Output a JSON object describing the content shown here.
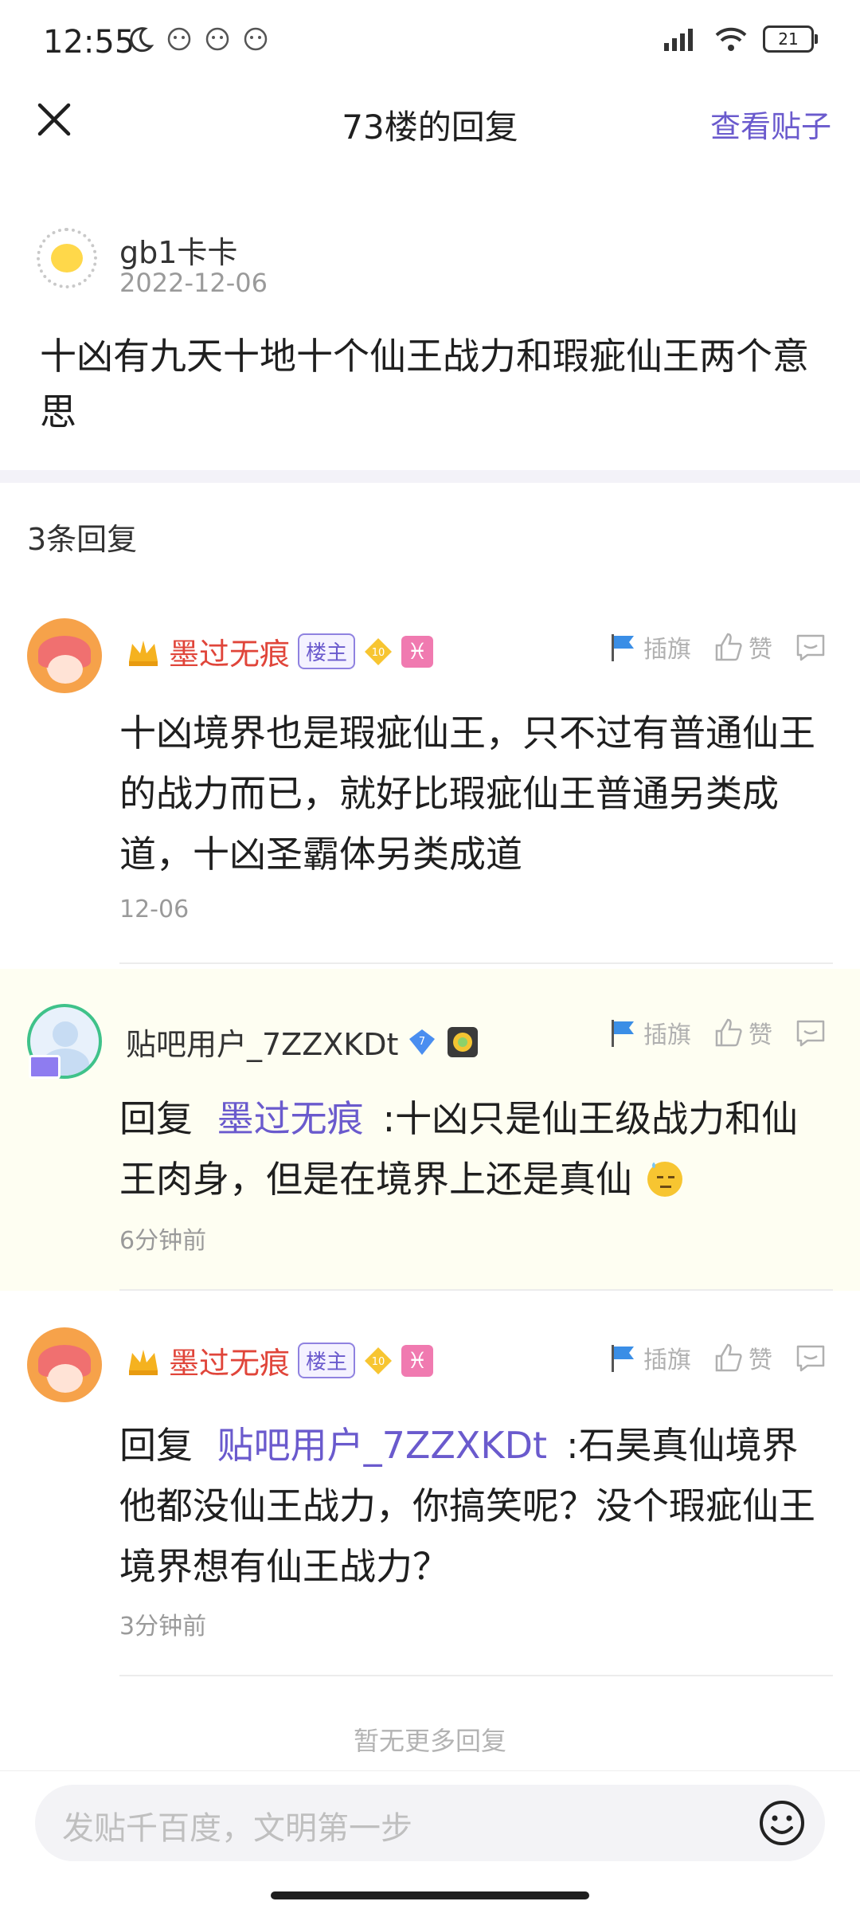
{
  "status_bar": {
    "time": "12:55",
    "battery": "21"
  },
  "header": {
    "title": "73楼的回复",
    "view_post": "查看贴子"
  },
  "op": {
    "name": "gb1卡卡",
    "date": "2022-12-06",
    "content": "十凶有九天十地十个仙王战力和瑕疵仙王两个意思"
  },
  "reply_count": "3条回复",
  "actions": {
    "flag": "插旗",
    "like": "赞"
  },
  "replies": [
    {
      "name": "墨过无痕",
      "tag": "楼主",
      "level": "10",
      "zodiac": "♓",
      "content": "十凶境界也是瑕疵仙王，只不过有普通仙王的战力而已，就好比瑕疵仙王普通另类成道，十凶圣霸体另类成道",
      "time": "12-06"
    },
    {
      "name": "贴吧用户_7ZZXKDt",
      "level": "7",
      "reply_prefix": "回复",
      "reply_to": "墨过无痕",
      "content": ":十凶只是仙王级战力和仙王肉身，但是在境界上还是真仙",
      "time": "6分钟前"
    },
    {
      "name": "墨过无痕",
      "tag": "楼主",
      "level": "10",
      "zodiac": "♓",
      "reply_prefix": "回复",
      "reply_to": "贴吧用户_7ZZXKDt",
      "content": ":石昊真仙境界他都没仙王战力，你搞笑呢？没个瑕疵仙王境界想有仙王战力？",
      "time": "3分钟前"
    }
  ],
  "footer": {
    "no_more": "暂无更多回复",
    "input_placeholder": "发贴千百度，文明第一步"
  },
  "colors": {
    "accent": "#6a5acd",
    "author_red": "#e0453a",
    "highlight_bg": "#fefef2"
  }
}
